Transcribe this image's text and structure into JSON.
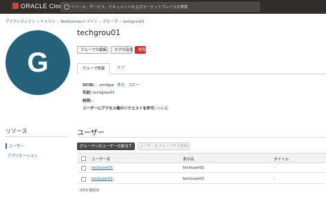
{
  "header": {
    "logo_text": "ORACLE Cloud",
    "search_placeholder": "リソース、サービス、ドキュメントおよびマーケットプレイスの検索"
  },
  "breadcrumb": [
    {
      "label": "アイデンティティ",
      "link": true
    },
    {
      "label": "ドメイン",
      "link": true
    },
    {
      "label": "TestDomainドメイン",
      "link": true
    },
    {
      "label": "グループ",
      "link": true
    },
    {
      "label": "techgrou01",
      "link": false
    }
  ],
  "avatar": {
    "letter": "G",
    "color": "#246279"
  },
  "page": {
    "title": "techgrou01"
  },
  "actions": {
    "edit": "グループの編集",
    "add_tags": "タグの追加",
    "delete": "削除"
  },
  "tabs": [
    {
      "label": "グループ情報",
      "active": true
    },
    {
      "label": "タグ",
      "active": false
    }
  ],
  "info": {
    "ocid_label": "OCID:",
    "ocid_value": "...omfqpa",
    "show_link": "表示",
    "copy_link": "コピー",
    "name_label": "名前:",
    "name_value": "techgrou01",
    "desc_label": "説明:",
    "desc_value": "-",
    "approval_label": "ユーザーにアクセス権のリクエストを許可:",
    "approval_value": "いいえ"
  },
  "resources": {
    "title": "リソース",
    "items": [
      {
        "label": "ユーザー",
        "active": true
      },
      {
        "label": "アプリケーション",
        "active": false
      }
    ]
  },
  "users": {
    "title": "ユーザー",
    "add_button": "グループへのユーザーの割当て",
    "remove_button": "ユーザーをグループから削除",
    "columns": [
      "ユーザー名",
      "表示名",
      "タイトル"
    ],
    "rows": [
      {
        "username": "techuser01",
        "display": "techuser01",
        "title": "-"
      },
      {
        "username": "techuser02",
        "display": "techuser02",
        "title": "-"
      }
    ],
    "selected_text": "0件を選択済"
  },
  "colors": {
    "brand": "#c74634",
    "topbar": "#312d2a",
    "link": "#2a6496",
    "danger": "#d62f2f"
  }
}
